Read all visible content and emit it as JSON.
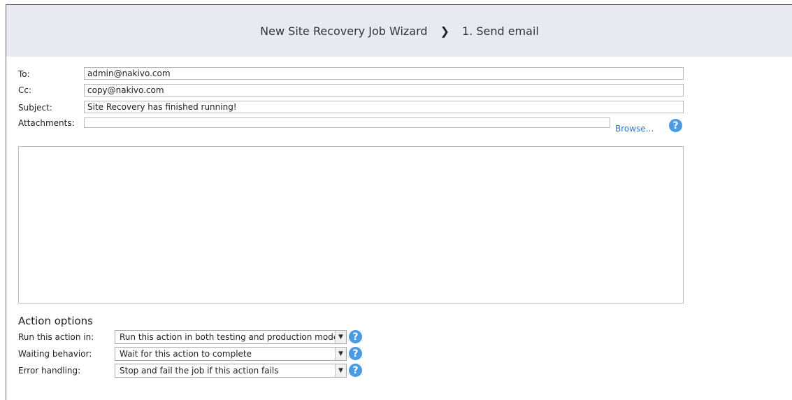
{
  "header": {
    "wizard_title": "New Site Recovery Job Wizard",
    "step_label": "1. Send email"
  },
  "email": {
    "to_label": "To:",
    "to_value": "admin@nakivo.com",
    "cc_label": "Cc:",
    "cc_value": "copy@nakivo.com",
    "subject_label": "Subject:",
    "subject_value": "Site Recovery has finished running!",
    "attachments_label": "Attachments:",
    "attachments_value": "",
    "browse_label": "Browse...",
    "body_value": ""
  },
  "action_options": {
    "title": "Action options",
    "run_in_label": "Run this action in:",
    "run_in_value": "Run this action in both testing and production mode",
    "waiting_label": "Waiting behavior:",
    "waiting_value": "Wait for this action to complete",
    "error_label": "Error handling:",
    "error_value": "Stop and fail the job if this action fails"
  },
  "icons": {
    "help": "help-icon",
    "chevron": "chevron-right-icon",
    "dropdown": "chevron-down-icon"
  },
  "colors": {
    "header_bg": "#e7eaf2",
    "link": "#2b7ad0",
    "help_bg": "#4a9ae4"
  }
}
